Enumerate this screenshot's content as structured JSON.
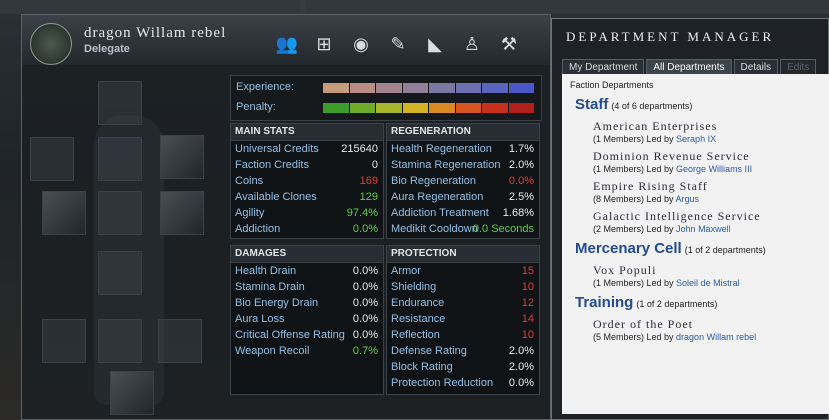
{
  "character": {
    "name": "dragon Willam rebel",
    "title": "Delegate",
    "toolbar": [
      {
        "icon": "people-icon",
        "glyph": "👥"
      },
      {
        "icon": "org-chart-icon",
        "glyph": "⊞"
      },
      {
        "icon": "group-icon",
        "glyph": "◉"
      },
      {
        "icon": "pen-icon",
        "glyph": "✎"
      },
      {
        "icon": "shard-icon",
        "glyph": "◣"
      },
      {
        "icon": "figure-icon",
        "glyph": "♙"
      },
      {
        "icon": "wrench-icon",
        "glyph": "⚒"
      }
    ],
    "bars": {
      "experience_label": "Experience:",
      "penalty_label": "Penalty:"
    },
    "main_stats": {
      "title": "MAIN STATS",
      "rows": [
        {
          "label": "Universal Credits",
          "value": "215640",
          "color": "white"
        },
        {
          "label": "Faction Credits",
          "value": "0",
          "color": "white"
        },
        {
          "label": "Coins",
          "value": "169",
          "color": "red"
        },
        {
          "label": "Available Clones",
          "value": "129",
          "color": "green"
        },
        {
          "label": "Agility",
          "value": "97.4%",
          "color": "green"
        },
        {
          "label": "Addiction",
          "value": "0.0%",
          "color": "green"
        }
      ]
    },
    "regeneration": {
      "title": "REGENERATION",
      "rows": [
        {
          "label": "Health Regeneration",
          "value": "1.7%",
          "color": "white"
        },
        {
          "label": "Stamina Regeneration",
          "value": "2.0%",
          "color": "white"
        },
        {
          "label": "Bio Regeneration",
          "value": "0.0%",
          "color": "red"
        },
        {
          "label": "Aura Regeneration",
          "value": "2.5%",
          "color": "white"
        },
        {
          "label": "Addiction Treatment",
          "value": "1.68%",
          "color": "white"
        },
        {
          "label": "Medikit Cooldown",
          "value": "0.0 Seconds",
          "color": "green"
        }
      ]
    },
    "damages": {
      "title": "DAMAGES",
      "rows": [
        {
          "label": "Health Drain",
          "value": "0.0%",
          "color": "white"
        },
        {
          "label": "Stamina Drain",
          "value": "0.0%",
          "color": "white"
        },
        {
          "label": "Bio Energy Drain",
          "value": "0.0%",
          "color": "white"
        },
        {
          "label": "Aura Loss",
          "value": "0.0%",
          "color": "white"
        },
        {
          "label": "Critical Offense Rating",
          "value": "0.0%",
          "color": "white"
        },
        {
          "label": "Weapon Recoil",
          "value": "0.7%",
          "color": "green"
        }
      ]
    },
    "protection": {
      "title": "PROTECTION",
      "rows": [
        {
          "label": "Armor",
          "value": "15",
          "color": "red"
        },
        {
          "label": "Shielding",
          "value": "10",
          "color": "red"
        },
        {
          "label": "Endurance",
          "value": "12",
          "color": "red"
        },
        {
          "label": "Resistance",
          "value": "14",
          "color": "red"
        },
        {
          "label": "Reflection",
          "value": "10",
          "color": "red"
        },
        {
          "label": "Defense Rating",
          "value": "2.0%",
          "color": "white"
        },
        {
          "label": "Block Rating",
          "value": "2.0%",
          "color": "white"
        },
        {
          "label": "Protection Reduction",
          "value": "0.0%",
          "color": "white"
        }
      ]
    }
  },
  "department_manager": {
    "title": "DEPARTMENT MANAGER",
    "tabs": [
      "My Department",
      "All Departments",
      "Details",
      "Edits"
    ],
    "faction_label": "Faction Departments",
    "groups": [
      {
        "name": "Staff",
        "count": "(4 of 6 departments)",
        "departments": [
          {
            "name": "American Enterprises",
            "members": "(1 Members) Led by",
            "leader": "Seraph IX"
          },
          {
            "name": "Dominion Revenue Service",
            "members": "(1 Members) Led by",
            "leader": "George Williams III"
          },
          {
            "name": "Empire Rising Staff",
            "members": "(8 Members) Led by",
            "leader": "Argus"
          },
          {
            "name": "Galactic Intelligence Service",
            "members": "(2 Members) Led by",
            "leader": "John Maxwell"
          }
        ]
      },
      {
        "name": "Mercenary Cell",
        "count": "(1 of 2 departments)",
        "departments": [
          {
            "name": "Vox Populi",
            "members": "(1 Members) Led by",
            "leader": "Soleil de Mistral"
          }
        ]
      },
      {
        "name": "Training",
        "count": "(1 of 2 departments)",
        "departments": [
          {
            "name": "Order of the Poet",
            "members": "(5 Members) Led by",
            "leader": "dragon Willam rebel"
          }
        ]
      }
    ]
  }
}
